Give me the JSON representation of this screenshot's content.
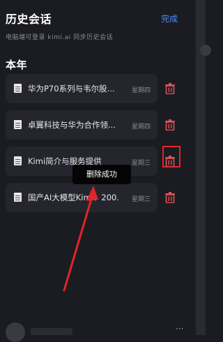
{
  "header": {
    "title": "历史会话",
    "done_label": "完成"
  },
  "login_hint": "电脑端可登录 kimi.ai 同步历史会话",
  "section": {
    "title": "本年"
  },
  "conversations": [
    {
      "title": "华为P70系列与韦尔股...",
      "day": "星期四"
    },
    {
      "title": "卓翼科技与华为合作领...",
      "day": "星期四"
    },
    {
      "title": "Kimi简介与服务提供",
      "day": "星期三"
    },
    {
      "title": "国产AI大模型Kimi：200...",
      "day": "星期三"
    }
  ],
  "toast": {
    "message": "删除成功"
  },
  "footer": {
    "more_label": "···"
  },
  "colors": {
    "accent": "#4d8df7",
    "trash": "#e0535a",
    "annotation_red": "#e0252b"
  }
}
